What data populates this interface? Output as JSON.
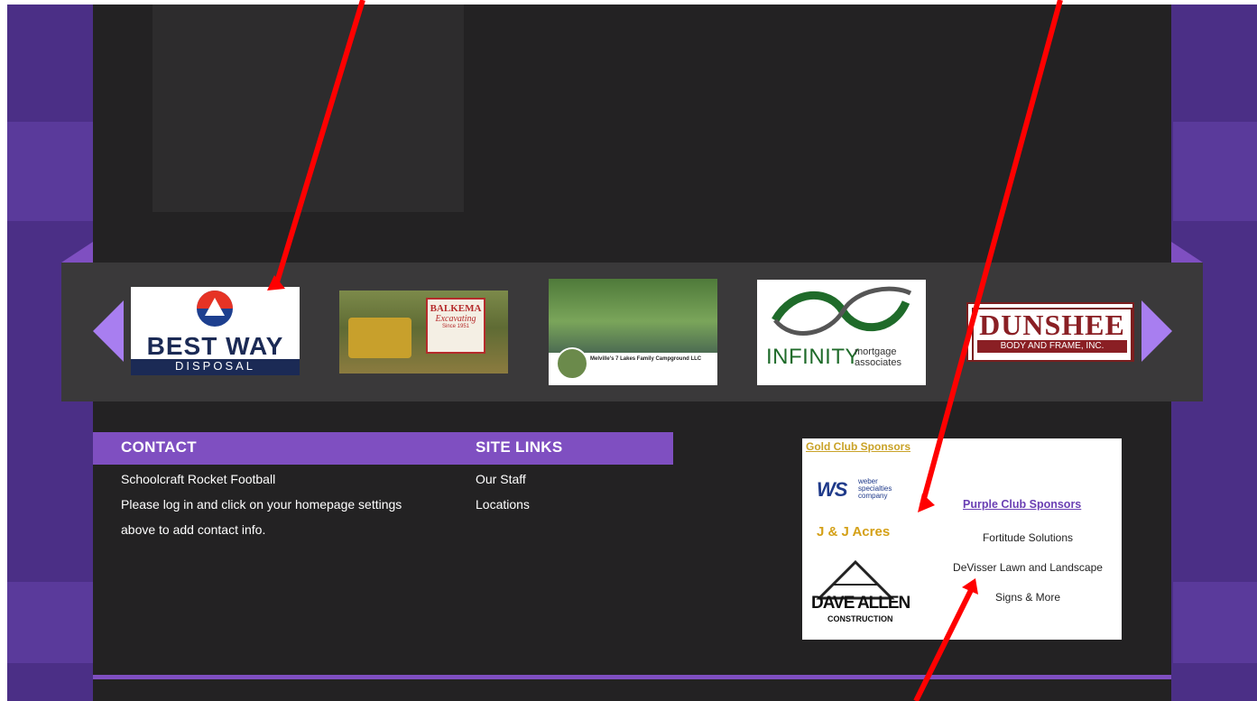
{
  "carousel": {
    "logos": [
      {
        "name": "best-way-disposal",
        "line1": "BEST WAY",
        "line2": "DISPOSAL"
      },
      {
        "name": "balkema-excavating",
        "line1": "BALKEMA",
        "line2": "Excavating",
        "line3": "Since 1951"
      },
      {
        "name": "melvilles-7-lakes",
        "caption": "Melville's 7 Lakes Family Campground LLC"
      },
      {
        "name": "infinity-mortgage",
        "brand": "INFINITY",
        "sub1": "mortgage",
        "sub2": "associates"
      },
      {
        "name": "dunshee",
        "line1": "DUNSHEE",
        "line2": "BODY AND FRAME, INC."
      }
    ]
  },
  "footer": {
    "contact_title": "CONTACT",
    "contact_lines": [
      "Schoolcraft Rocket Football",
      "Please log in and click on your homepage settings",
      "above to add contact info."
    ],
    "links_title": "SITE LINKS",
    "links": [
      "Our Staff",
      "Locations"
    ]
  },
  "sponsors": {
    "gold_title": "Gold Club Sponsors",
    "weber_logo": "WS",
    "weber_text": [
      "weber",
      "specialties",
      "company"
    ],
    "jj_acres": "J & J Acres",
    "dave_allen": [
      "DAVE ALLEN",
      "CONSTRUCTION"
    ],
    "purple_title": "Purple Club Sponsors",
    "purple_list": [
      "Fortitude Solutions",
      "DeVisser Lawn and Landscape",
      "Signs & More"
    ]
  },
  "colors": {
    "background_purple": "#4b2f86",
    "main_dark": "#232223",
    "accent_purple": "#7f4fc1",
    "annotation_red": "#ff0000"
  }
}
